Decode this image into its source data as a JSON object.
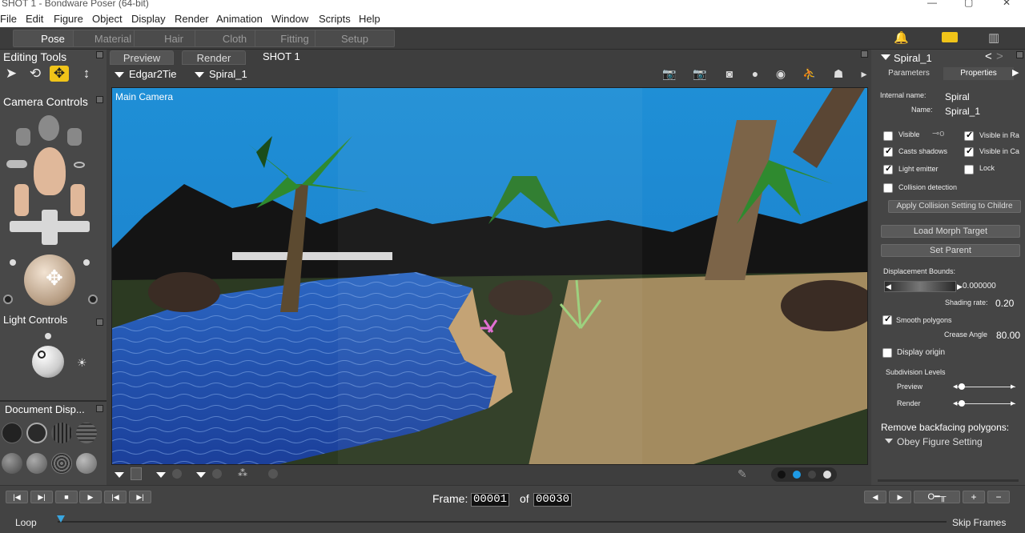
{
  "window": {
    "title": "SHOT 1 - Bondware Poser (64-bit)",
    "controls": [
      "—",
      "▢",
      "✕"
    ]
  },
  "menu": [
    "File",
    "Edit",
    "Figure",
    "Object",
    "Display",
    "Render",
    "Animation",
    "Window",
    "Scripts",
    "Help"
  ],
  "rooms": [
    {
      "label": "Pose",
      "active": true
    },
    {
      "label": "Material"
    },
    {
      "label": "Hair"
    },
    {
      "label": "Cloth"
    },
    {
      "label": "Fitting"
    },
    {
      "label": "Setup"
    }
  ],
  "left": {
    "editing_tools": "Editing Tools",
    "camera_controls": "Camera Controls",
    "light_controls": "Light Controls",
    "document_display": "Document  Disp..."
  },
  "viewport": {
    "tabs": [
      "Preview",
      "Render"
    ],
    "doc_title": "SHOT 1",
    "figure_select": "Edgar2Tie",
    "actor_select": "Spiral_1",
    "camera_label": "Main Camera"
  },
  "right": {
    "title": "Spiral_1",
    "tabs": [
      "Parameters",
      "Properties"
    ],
    "internal_name_label": "Internal name:",
    "internal_name": "Spiral",
    "name_label": "Name:",
    "name": "Spiral_1",
    "checks": {
      "visible": "Visible",
      "visible_in_raytracing": "Visible in Ra",
      "casts_shadows": "Casts shadows",
      "visible_in_camera": "Visible in Ca",
      "light_emitter": "Light emitter",
      "lock": "Lock",
      "collision_detection": "Collision detection"
    },
    "apply_collision": "Apply Collision Setting to Childre",
    "load_morph": "Load Morph Target",
    "set_parent": "Set Parent",
    "displacement_label": "Displacement Bounds:",
    "displacement_value": "0.000000",
    "shading_label": "Shading rate:",
    "shading_value": "0.20",
    "smooth_polygons": "Smooth polygons",
    "crease_label": "Crease Angle",
    "crease_value": "80.00",
    "display_origin": "Display origin",
    "subdivision": "Subdivision Levels",
    "sub_preview": "Preview",
    "sub_render": "Render",
    "remove_backfacing": "Remove backfacing polygons:",
    "obey_figure": "Obey Figure Setting"
  },
  "timeline": {
    "frame_label": "Frame:",
    "frame_value": "00001",
    "of_label": "of",
    "total_value": "00030",
    "loop": "Loop",
    "skip_frames": "Skip Frames"
  },
  "colors": {
    "sky": "#1f8fd6",
    "water": "#1f4fb0",
    "sand": "#b89a6a",
    "ground": "#2c3a22",
    "highlight": "#f0c419"
  }
}
